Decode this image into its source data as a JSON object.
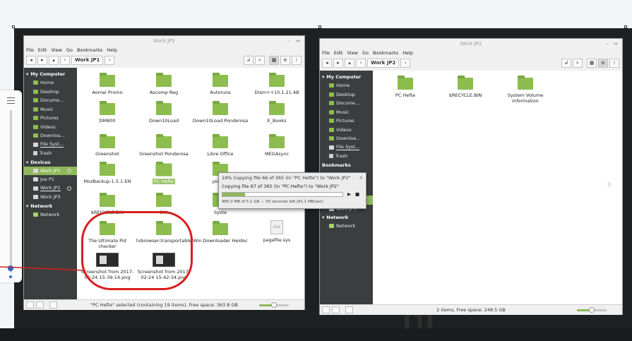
{
  "left_window": {
    "title": "Work JP1",
    "menu": [
      "File",
      "Edit",
      "View",
      "Go",
      "Bookmarks",
      "Help"
    ],
    "path": "Work JP1",
    "sidebar": {
      "my_computer": "My Computer",
      "places": [
        "Home",
        "Desktop",
        "Docume...",
        "Music",
        "Pictures",
        "Videos",
        "Downloa...",
        "File Syst...",
        "Trash"
      ],
      "devices_head": "Devices",
      "devices": [
        "Work JP1",
        "Joe P1",
        "Work JP2",
        "Work JP3"
      ],
      "network_head": "Network",
      "network": [
        "Network"
      ]
    },
    "items": [
      {
        "name": "Aomei Promo"
      },
      {
        "name": "Ascomp Reg"
      },
      {
        "name": "Autoruns"
      },
      {
        "name": "Dism++10.1.21.4B"
      },
      {
        "name": "DM800"
      },
      {
        "name": "Down10Load"
      },
      {
        "name": "Down10Load Ponderosa"
      },
      {
        "name": "E_Books"
      },
      {
        "name": "Greenshot"
      },
      {
        "name": "Greenshot Ponderosa"
      },
      {
        "name": "Libre Office"
      },
      {
        "name": "MEGAsync"
      },
      {
        "name": "MozBackup-1.5.1-EN"
      },
      {
        "name": "PC Hefte"
      },
      {
        "name": "pidgen"
      },
      {
        "name": "$RECYCLE.BIN"
      },
      {
        "name": "SKY"
      },
      {
        "name": "Syste"
      },
      {
        "name": "The Ultimate Pid checker"
      },
      {
        "name": "tvbrowser-transportable"
      },
      {
        "name": "Win Downloader Heidoc"
      },
      {
        "name": "pagefile.sys"
      },
      {
        "name": "Screenshot from 2017-02-24 15-39-14.png"
      },
      {
        "name": "Screenshot from 2017-02-24 15-42-34.png"
      }
    ],
    "status": "\"PC Hefte\" selected (containing 19 items), Free space: 363.8 GB",
    "zoom_level": 0.5
  },
  "right_window": {
    "title": "Work JP2",
    "menu": [
      "File",
      "Edit",
      "View",
      "Go",
      "Bookmarks",
      "Help"
    ],
    "path": "Work JP2",
    "sidebar": {
      "my_computer": "My Computer",
      "places": [
        "Home",
        "Desktop",
        "Docume...",
        "Music",
        "Pictures",
        "Videos",
        "Downloa...",
        "File Syst...",
        "Trash"
      ],
      "bookmarks_head": "Bookmarks",
      "devices": [
        "Work JP3"
      ],
      "network_head": "Network",
      "network": [
        "Network"
      ]
    },
    "items": [
      {
        "name": "PC Hefte"
      },
      {
        "name": "$RECYCLE.BIN"
      },
      {
        "name": "System Volume Information"
      }
    ],
    "status": "2 items, Free space: 248.5 GB",
    "zoom_level": 0.5
  },
  "copy_dialog": {
    "title": "19% Copying file 66 of 365 (in \"PC Hefte\") to \"Work JP2\"",
    "line": "Copying file 67 of 365 (in \"PC Hefte\") to \"Work JP2\"",
    "progress": 0.19,
    "details": "985.0 MB of 5.1 GB — 50 seconds left (81.1 MB/sec)"
  },
  "colors": {
    "accent": "#8fb85a",
    "folder": "#8cbd4e",
    "sidebar": "#3b3e3f",
    "annotation": "#d81e1e"
  }
}
